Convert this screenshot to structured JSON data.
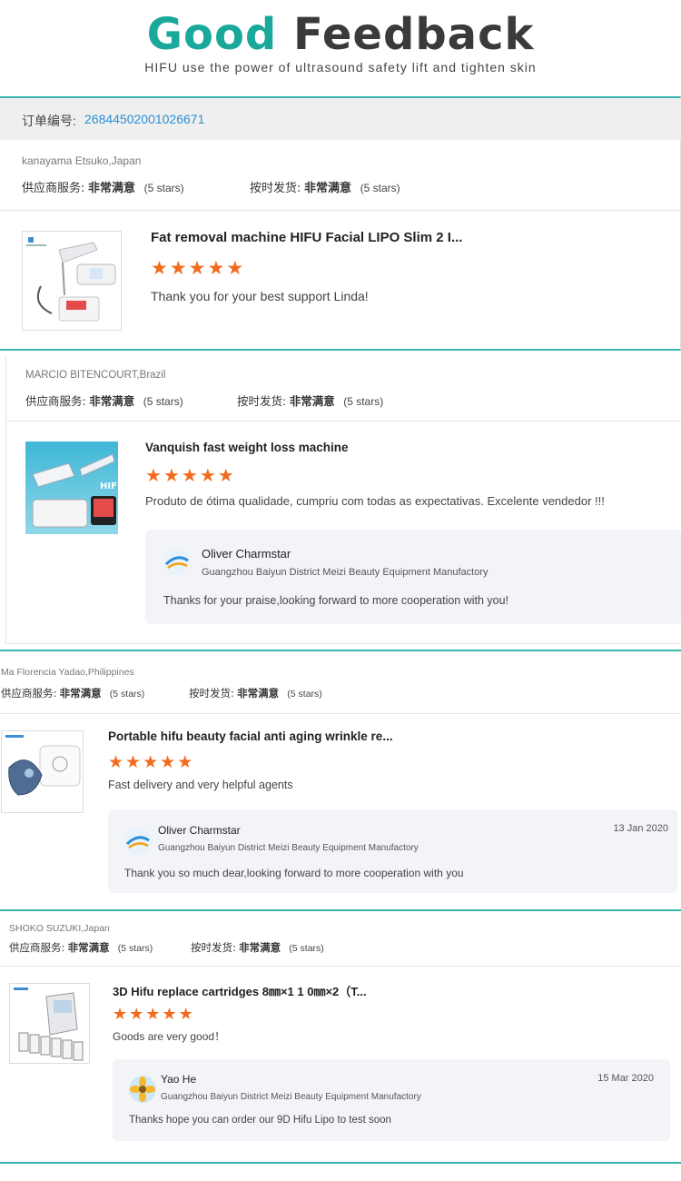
{
  "header": {
    "title_word1": "Good",
    "title_word2": "Feedback",
    "subtitle": "HIFU use the power of ultrasound safety lift and tighten skin"
  },
  "order": {
    "label": "订单编号:",
    "number": "26844502001026671"
  },
  "colors": {
    "accent_teal": "#1aa89b",
    "star_orange": "#f26b1d",
    "order_number_blue": "#2b8fd6"
  },
  "reviews": [
    {
      "customer": "kanayama Etsuko,Japan",
      "service_label": "供应商服务:",
      "service_value": "非常满意",
      "service_stars": "(5 stars)",
      "ship_label": "按时发货:",
      "ship_value": "非常满意",
      "ship_stars": "(5 stars)",
      "product_title": "Fat removal machine HIFU Facial LIPO Slim 2 I...",
      "rating": 5,
      "comment": "Thank you for your best support Linda!",
      "product_icon": "hifu-handpiece-machine-icon"
    },
    {
      "customer": "MARCIO BITENCOURT,Brazil",
      "service_label": "供应商服务:",
      "service_value": "非常满意",
      "service_stars": "(5 stars)",
      "ship_label": "按时发货:",
      "ship_value": "非常满意",
      "ship_stars": "(5 stars)",
      "product_title": "Vanquish fast weight loss machine",
      "rating": 5,
      "comment": "Produto de ótima qualidade, cumpriu com todas as expectativas. Excelente vendedor !!!",
      "product_icon": "hifu-machine-icon",
      "image_text": "HIF",
      "reply": {
        "name": "Oliver Charmstar",
        "company": "Guangzhou Baiyun District Meizi Beauty Equipment Manufactory",
        "text": "Thanks for your praise,looking forward to more cooperation with you!"
      }
    },
    {
      "customer": "Ma Florencia Yadao,Philippines",
      "service_label": "供应商服务:",
      "service_value": "非常满意",
      "service_stars": "(5 stars)",
      "ship_label": "按时发货:",
      "ship_value": "非常满意",
      "ship_stars": "(5 stars)",
      "product_title": "Portable hifu beauty facial anti aging wrinkle re...",
      "rating": 5,
      "comment": "Fast delivery and very helpful agents",
      "product_icon": "portable-hifu-device-icon",
      "reply": {
        "name": "Oliver Charmstar",
        "company": "Guangzhou Baiyun District Meizi Beauty Equipment Manufactory",
        "date": "13 Jan 2020",
        "text": "Thank you so much dear,looking forward to more cooperation with you"
      }
    },
    {
      "customer": "SHOKO SUZUKI,Japan",
      "service_label": "供应商服务:",
      "service_value": "非常满意",
      "service_stars": "(5 stars)",
      "ship_label": "按时发货:",
      "ship_value": "非常满意",
      "ship_stars": "(5 stars)",
      "product_title": "3D Hifu replace cartridges 8㎜×1 1 0㎜×2（T...",
      "rating": 5,
      "comment": "Goods are very good！",
      "product_icon": "hifu-cartridges-icon",
      "reply": {
        "name": "Yao He",
        "company": "Guangzhou Baiyun District Meizi Beauty Equipment Manufactory",
        "date": "15 Mar 2020",
        "text": "Thanks hope you can order our 9D Hifu Lipo to test soon"
      }
    }
  ]
}
